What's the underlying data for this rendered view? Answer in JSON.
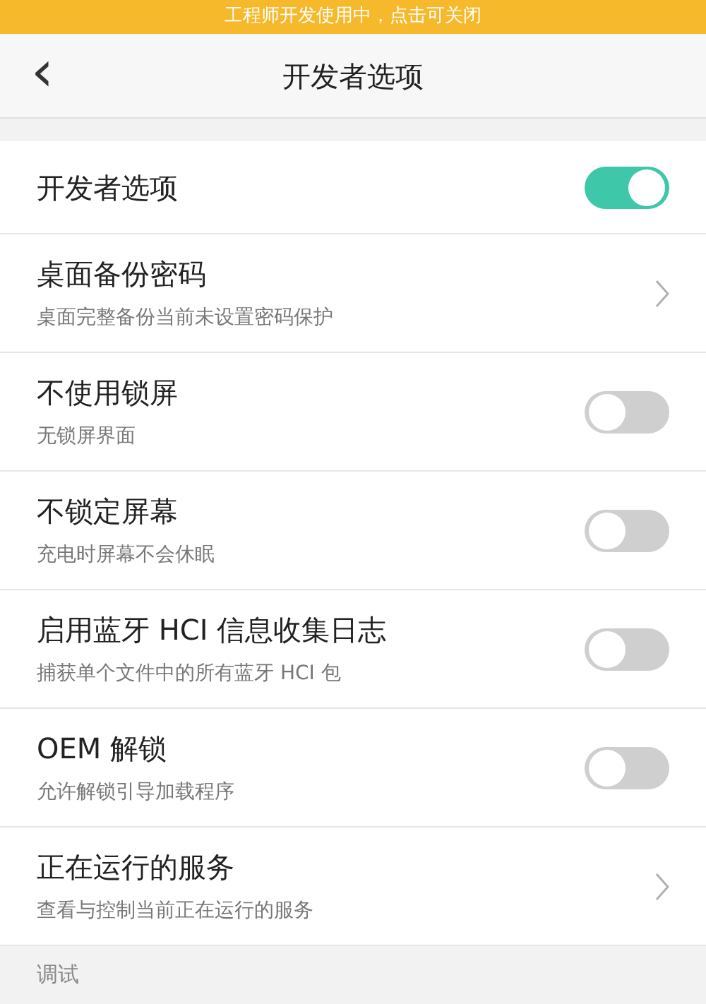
{
  "banner": {
    "text": "工程师开发使用中，点击可关闭"
  },
  "header": {
    "back": "‹",
    "title": "开发者选项"
  },
  "master": {
    "label": "开发者选项",
    "on": true
  },
  "items": [
    {
      "kind": "link",
      "title": "桌面备份密码",
      "subtitle": "桌面完整备份当前未设置密码保护"
    },
    {
      "kind": "toggle",
      "title": "不使用锁屏",
      "subtitle": "无锁屏界面",
      "on": false
    },
    {
      "kind": "toggle",
      "title": "不锁定屏幕",
      "subtitle": "充电时屏幕不会休眠",
      "on": false
    },
    {
      "kind": "toggle",
      "title": "启用蓝牙 HCI 信息收集日志",
      "subtitle": "捕获单个文件中的所有蓝牙 HCI 包",
      "on": false
    },
    {
      "kind": "toggle",
      "title": "OEM 解锁",
      "subtitle": "允许解锁引导加载程序",
      "on": false
    },
    {
      "kind": "link",
      "title": "正在运行的服务",
      "subtitle": "查看与控制当前正在运行的服务"
    }
  ],
  "section": {
    "title": "调试"
  }
}
